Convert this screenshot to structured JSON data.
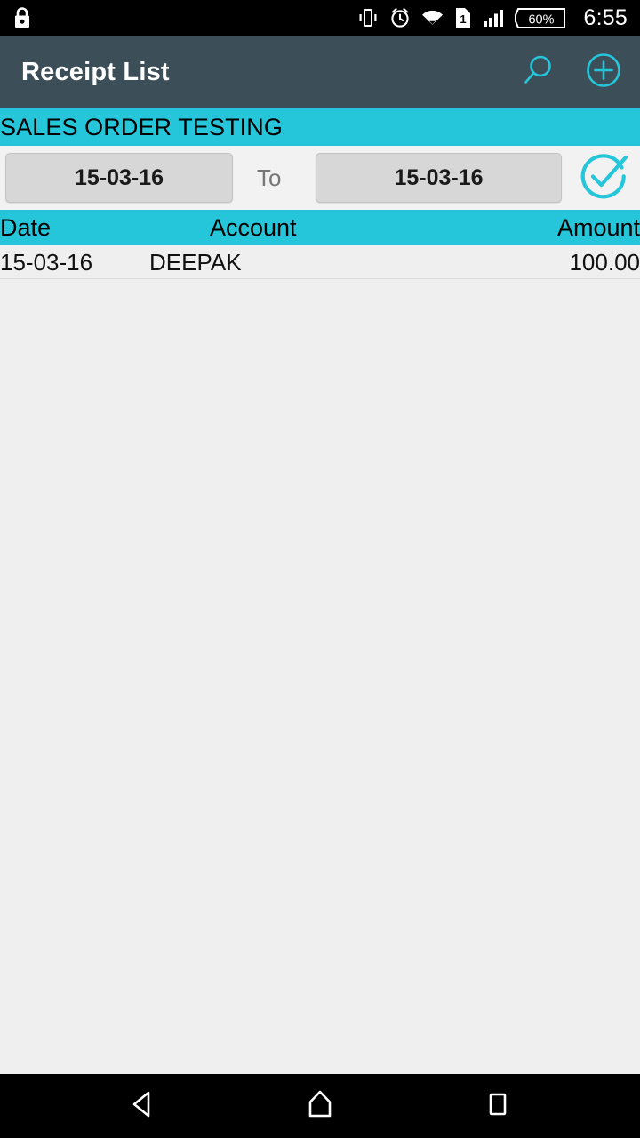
{
  "statusbar": {
    "lock_icon": "lock-icon",
    "vibrate_icon": "vibrate-icon",
    "alarm_icon": "alarm-icon",
    "wifi_icon": "wifi-icon",
    "sim_icon": "sim-card-icon",
    "sim_label": "1",
    "signal_icon": "cellular-signal-icon",
    "battery_icon": "battery-icon",
    "battery_level": "60%",
    "time": "6:55"
  },
  "appbar": {
    "title": "Receipt List",
    "search_icon": "search-icon",
    "add_icon": "add-circle-icon",
    "background": "#3C4F59",
    "accent": "#26C6DA"
  },
  "company": {
    "name": "SALES ORDER TESTING",
    "background": "#26C6DA"
  },
  "filter": {
    "from_date": "15-03-16",
    "to_label": "To",
    "to_date": "15-03-16",
    "confirm_icon": "check-circle-icon",
    "button_background": "#D6D7D6",
    "confirm_color": "#26C6DA"
  },
  "table": {
    "columns": [
      "Date",
      "Account",
      "Amount"
    ],
    "rows": [
      {
        "date": "15-03-16",
        "account": "DEEPAK",
        "amount": "100.00"
      }
    ]
  },
  "navbar": {
    "back_icon": "back-triangle-icon",
    "home_icon": "home-icon",
    "recents_icon": "recents-square-icon"
  }
}
